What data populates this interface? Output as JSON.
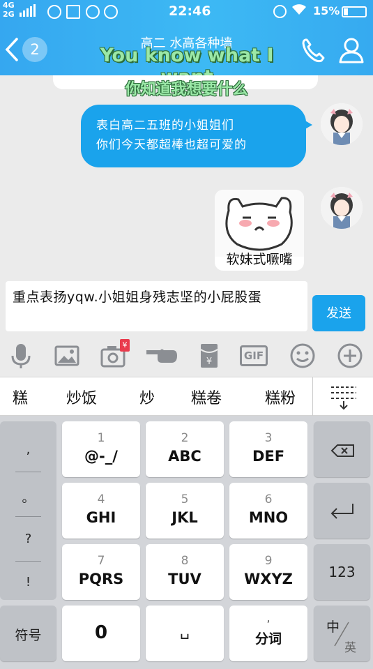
{
  "status_bar": {
    "network": "4G\n2G",
    "time": "22:46",
    "battery": "15%"
  },
  "header": {
    "unread_count": "2",
    "title": "高二  水高各种墙",
    "overlay_en": "You know what I want",
    "overlay_cn": "你知道我想要什么"
  },
  "messages": [
    {
      "type": "text",
      "lines": [
        "表白高二五班的小姐姐们",
        "你们今天都超棒也超可爱的"
      ]
    },
    {
      "type": "sticker",
      "caption": "软妹式噘嘴"
    }
  ],
  "composer": {
    "input_value": "重点表扬yqw.小姐姐身残志坚的小屁股蛋",
    "send_label": "发送"
  },
  "toolbar_icons": [
    "microphone-icon",
    "image-icon",
    "camera-icon",
    "poke-icon",
    "red-packet-icon",
    "gif-icon",
    "emoji-icon",
    "plus-icon"
  ],
  "toolbar_labels": {
    "gif": "GIF",
    "yen": "¥"
  },
  "candidates": [
    "糕",
    "炒饭",
    "炒",
    "糕卷",
    "糕粉"
  ],
  "keyboard": {
    "punctuation": [
      ",",
      "。",
      "?",
      "!"
    ],
    "keys": [
      {
        "num": "1",
        "letters": "@-_/"
      },
      {
        "num": "2",
        "letters": "ABC"
      },
      {
        "num": "3",
        "letters": "DEF"
      },
      {
        "num": "4",
        "letters": "GHI"
      },
      {
        "num": "5",
        "letters": "JKL"
      },
      {
        "num": "6",
        "letters": "MNO"
      },
      {
        "num": "7",
        "letters": "PQRS"
      },
      {
        "num": "8",
        "letters": "TUV"
      },
      {
        "num": "9",
        "letters": "WXYZ"
      }
    ],
    "num_switch": "123",
    "symbol_key": "符号",
    "zero_key": "0",
    "space_key": "␣",
    "word_key_top": ",",
    "word_key": "分词",
    "lang_key_cn": "中",
    "lang_key_en": "英"
  },
  "colors": {
    "accent": "#1aa3ec",
    "header_start": "#35a7f0",
    "overlay_text": "#9be8a7"
  }
}
